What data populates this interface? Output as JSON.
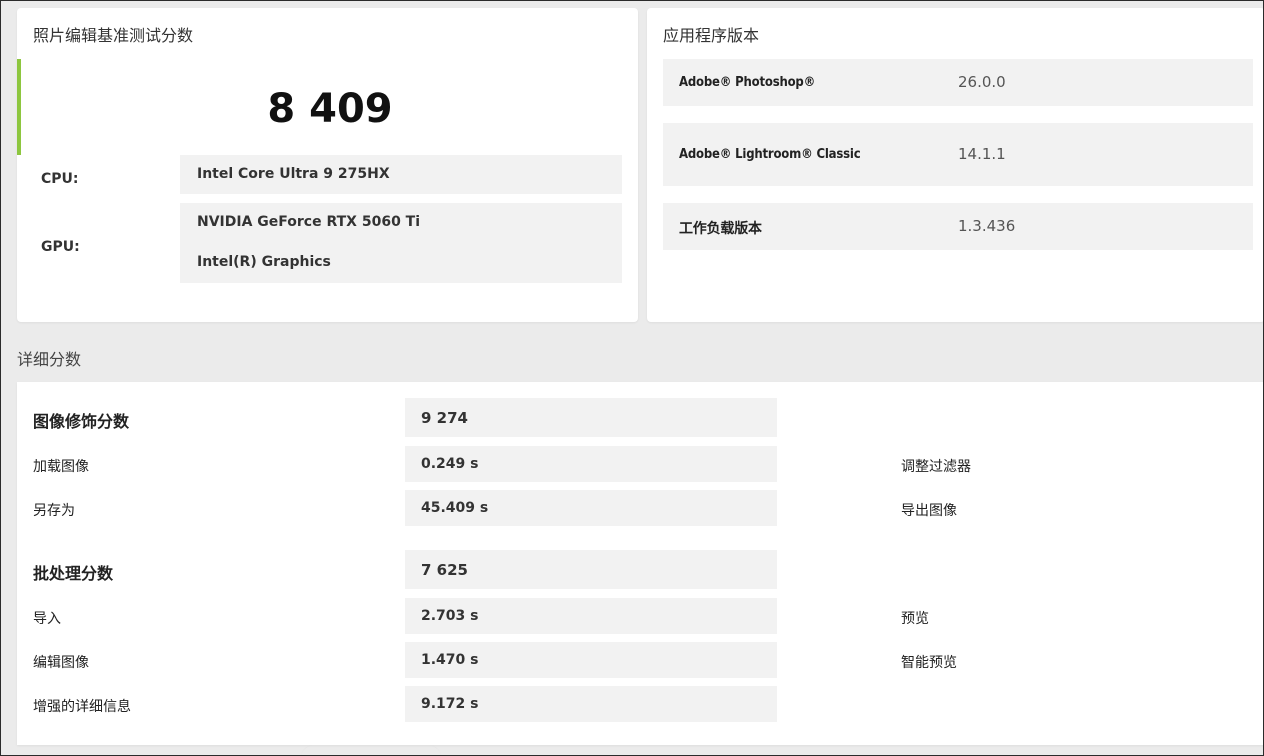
{
  "score_card": {
    "title": "照片编辑基准测试分数",
    "score": "8 409",
    "cpu_label": "CPU:",
    "cpu_value": "Intel Core Ultra 9 275HX",
    "gpu_label": "GPU:",
    "gpu_values": [
      "NVIDIA GeForce RTX 5060 Ti",
      "Intel(R) Graphics"
    ],
    "accent_color": "#8dc63f"
  },
  "versions_card": {
    "title": "应用程序版本",
    "rows": [
      {
        "name": "Adobe® Photoshop®",
        "value": "26.0.0"
      },
      {
        "name": "Adobe® Lightroom® Classic",
        "value": "14.1.1"
      },
      {
        "name": "工作负载版本",
        "value": "1.3.436"
      }
    ]
  },
  "details": {
    "title": "详细分数",
    "groups": [
      {
        "label": "图像修饰分数",
        "value": "9 274",
        "items": [
          {
            "label": "加载图像",
            "value": "0.249 s",
            "right": "调整过滤器"
          },
          {
            "label": "另存为",
            "value": "45.409 s",
            "right": "导出图像"
          }
        ]
      },
      {
        "label": "批处理分数",
        "value": "7 625",
        "items": [
          {
            "label": "导入",
            "value": "2.703 s",
            "right": "预览"
          },
          {
            "label": "编辑图像",
            "value": "1.470 s",
            "right": "智能预览"
          },
          {
            "label": "增强的详细信息",
            "value": "9.172 s",
            "right": ""
          }
        ]
      }
    ]
  }
}
